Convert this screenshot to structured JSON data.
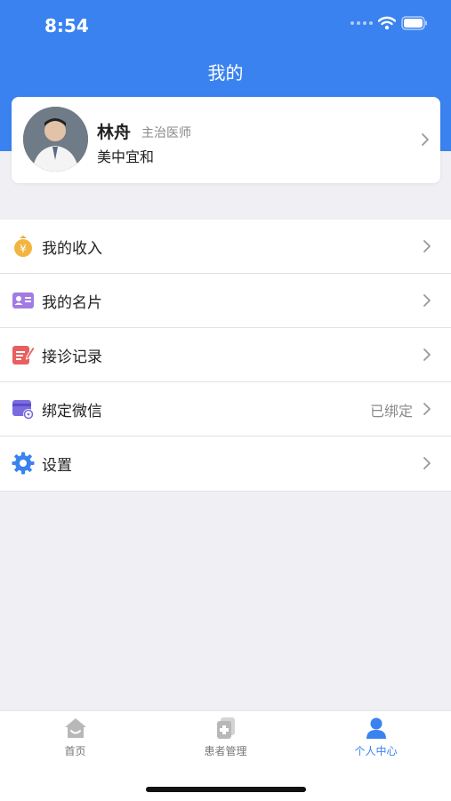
{
  "status": {
    "time": "8:54"
  },
  "header": {
    "title": "我的"
  },
  "profile": {
    "name": "林舟",
    "title": "主治医师",
    "hospital": "美中宜和"
  },
  "menu": [
    {
      "label": "我的收入",
      "icon": "yuan-coin-icon",
      "value": ""
    },
    {
      "label": "我的名片",
      "icon": "business-card-icon",
      "value": ""
    },
    {
      "label": "接诊记录",
      "icon": "record-edit-icon",
      "value": ""
    },
    {
      "label": "绑定微信",
      "icon": "wechat-bind-icon",
      "value": "已绑定"
    },
    {
      "label": "设置",
      "icon": "gear-icon",
      "value": ""
    }
  ],
  "tabbar": [
    {
      "label": "首页",
      "icon": "home-icon",
      "active": false
    },
    {
      "label": "患者管理",
      "icon": "patient-records-icon",
      "active": false
    },
    {
      "label": "个人中心",
      "icon": "person-icon",
      "active": true
    }
  ],
  "colors": {
    "accent": "#3a82f0",
    "background": "#efeff4"
  }
}
